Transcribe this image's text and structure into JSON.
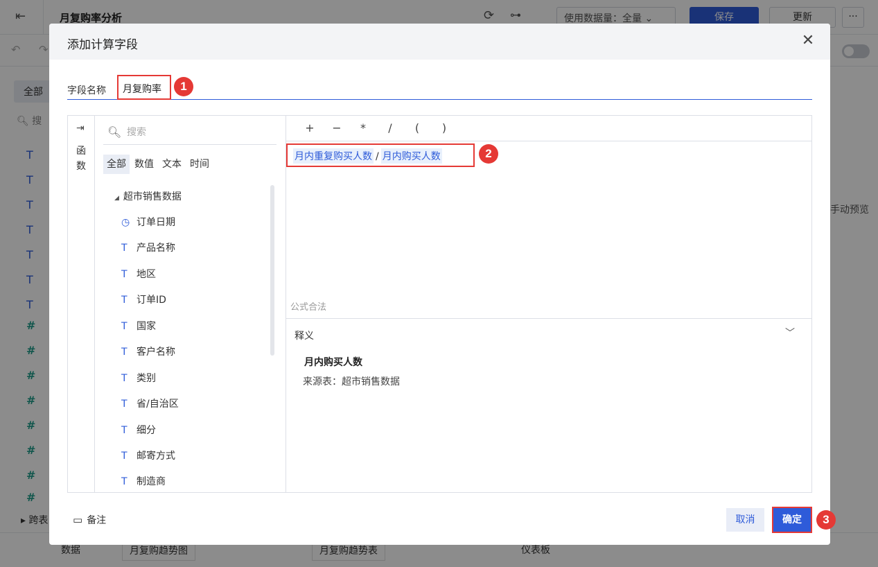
{
  "app": {
    "title": "月复购率分析",
    "usage_label": "使用数据量：全量",
    "save_label": "保存",
    "update_label": "更新",
    "more_label": "···",
    "left_all_label": "全部",
    "left_search_label": "搜",
    "cross_table_label": "跨表",
    "right_preview_label": "手动预览",
    "bottom_data_label": "数据",
    "bottom_tabs": [
      "月复购趋势图",
      "月复购趋势表"
    ],
    "bottom_dashboard_label": "仪表板"
  },
  "dialog": {
    "title": "添加计算字段",
    "field_name_label": "字段名称",
    "field_name_value": "月复购率",
    "function_label": "函数",
    "search_placeholder": "搜索",
    "tabs": [
      "全部",
      "数值",
      "文本",
      "时间"
    ],
    "tree_root": "超市销售数据",
    "fields": [
      {
        "icon": "clock-icon",
        "label": "订单日期"
      },
      {
        "icon": "text-type-icon",
        "label": "产品名称"
      },
      {
        "icon": "text-type-icon",
        "label": "地区"
      },
      {
        "icon": "text-type-icon",
        "label": "订单ID"
      },
      {
        "icon": "text-type-icon",
        "label": "国家"
      },
      {
        "icon": "text-type-icon",
        "label": "客户名称"
      },
      {
        "icon": "text-type-icon",
        "label": "类别"
      },
      {
        "icon": "text-type-icon",
        "label": "省/自治区"
      },
      {
        "icon": "text-type-icon",
        "label": "细分"
      },
      {
        "icon": "text-type-icon",
        "label": "邮寄方式"
      },
      {
        "icon": "text-type-icon",
        "label": "制造商"
      }
    ],
    "operators": [
      "+",
      "−",
      "*",
      "/",
      "(",
      ")"
    ],
    "formula": {
      "operand1": "月内重复购买人数",
      "operator": "/",
      "operand2": "月内购买人数"
    },
    "validation": "公式合法",
    "explain": {
      "title": "释义",
      "field_name": "月内购买人数",
      "source": "来源表：超市销售数据"
    },
    "note_label": "备注",
    "cancel_label": "取消",
    "ok_label": "确定",
    "badges": [
      "1",
      "2",
      "3"
    ]
  },
  "colors": {
    "primary": "#2e5bd9",
    "highlight": "#e53935",
    "chip_bg": "#e8f0fc"
  }
}
